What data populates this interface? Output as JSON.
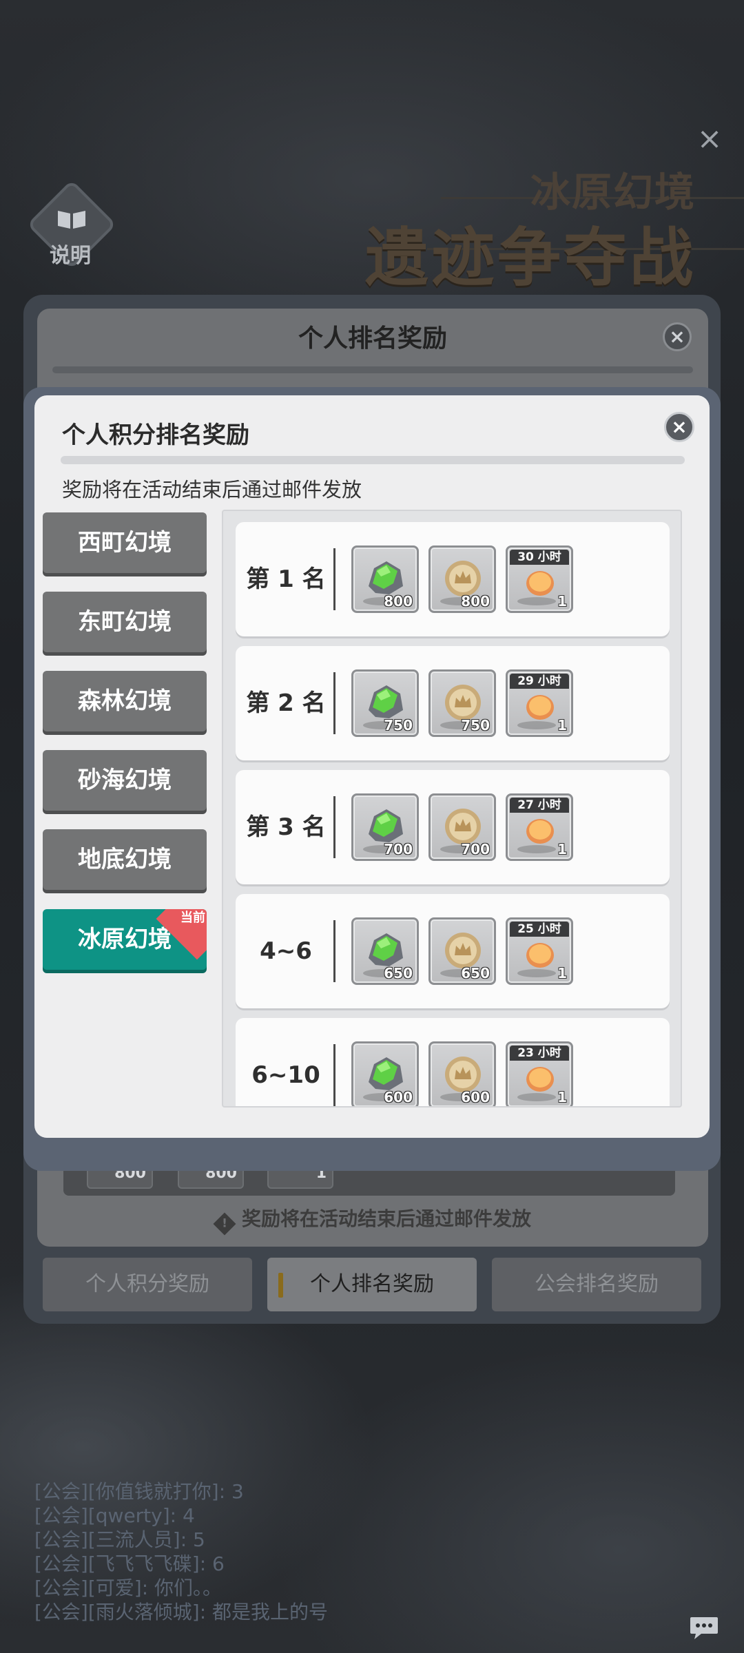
{
  "header": {
    "close_symbol": "×",
    "intro_label": "说明",
    "event_subtitle": "冰原幻境",
    "event_title": "遗迹争夺战"
  },
  "back_panel": {
    "title": "个人排名奖励",
    "close_symbol": "×",
    "chip_values": [
      "800",
      "800",
      "1"
    ],
    "note": "奖励将在活动结束后通过邮件发放",
    "tabs": [
      {
        "label": "个人积分奖励",
        "active": false
      },
      {
        "label": "个人排名奖励",
        "active": true
      },
      {
        "label": "公会排名奖励",
        "active": false
      }
    ]
  },
  "modal": {
    "title": "个人积分排名奖励",
    "close_symbol": "×",
    "note": "奖励将在活动结束后通过邮件发放",
    "realms": [
      {
        "label": "西町幻境",
        "current": false
      },
      {
        "label": "东町幻境",
        "current": false
      },
      {
        "label": "森林幻境",
        "current": false
      },
      {
        "label": "砂海幻境",
        "current": false
      },
      {
        "label": "地底幻境",
        "current": false
      },
      {
        "label": "冰原幻境",
        "current": true,
        "badge": "当前"
      }
    ],
    "ranks": [
      {
        "label": "第 1 名",
        "gem": "800",
        "coin": "800",
        "timer": "30 小时",
        "token": "1"
      },
      {
        "label": "第 2 名",
        "gem": "750",
        "coin": "750",
        "timer": "29 小时",
        "token": "1"
      },
      {
        "label": "第 3 名",
        "gem": "700",
        "coin": "700",
        "timer": "27 小时",
        "token": "1"
      },
      {
        "label": "4~6",
        "gem": "650",
        "coin": "650",
        "timer": "25 小时",
        "token": "1"
      },
      {
        "label": "6~10",
        "gem": "600",
        "coin": "600",
        "timer": "23 小时",
        "token": "1"
      }
    ]
  },
  "chat": [
    "[公会][你值钱就打你]: 3",
    "[公会][qwerty]: 4",
    "[公会][三流人员]: 5",
    "[公会][飞飞飞飞碟]: 6",
    "[公会][可爱]: 你们。。",
    "[公会][雨火落倾城]: 都是我上的号"
  ],
  "icons": {
    "gem": "green-ore-icon",
    "coin": "crown-coin-icon",
    "token": "orange-token-icon",
    "chat": "chat-bubble-icon",
    "intro": "book-icon"
  },
  "colors": {
    "current_realm": "#0e9385",
    "current_badge": "#e8595d",
    "realm_tab": "#737475"
  }
}
